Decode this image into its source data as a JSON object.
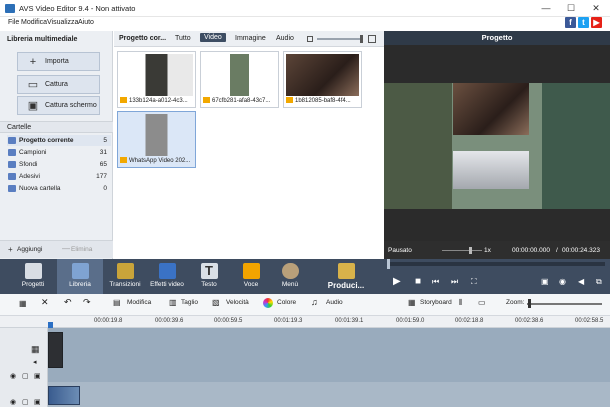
{
  "window": {
    "title": "AVS Video Editor 9.4 - Non attivato",
    "minimize": "—",
    "maximize": "☐",
    "close": "✕"
  },
  "menu": [
    "File",
    "Modifica",
    "Visualizza",
    "Aiuto"
  ],
  "social": {
    "facebook": "f",
    "twitter": "t",
    "youtube": "▶"
  },
  "library": {
    "title": "Libreria multimediale",
    "import_label": "Importa",
    "capture_label": "Cattura",
    "screen_capture_label": "Cattura schermo",
    "folders_title": "Cartelle",
    "folders": [
      {
        "name": "Progetto corrente",
        "count": "5"
      },
      {
        "name": "Campioni",
        "count": "31"
      },
      {
        "name": "Sfondi",
        "count": "65"
      },
      {
        "name": "Adesivi",
        "count": "177"
      },
      {
        "name": "Nuova cartella",
        "count": "0"
      }
    ],
    "add_label": "Aggiungi",
    "delete_label": "Elimina"
  },
  "media": {
    "project_label": "Progetto cor...",
    "tabs": [
      "Tutto",
      "Video",
      "Immagine",
      "Audio"
    ],
    "items": [
      {
        "name": "133b124a-a012-4c3..."
      },
      {
        "name": "67cfb281-afa8-43c7..."
      },
      {
        "name": "1b812085-baf8-4f4..."
      },
      {
        "name": "WhatsApp Video 202..."
      }
    ]
  },
  "preview": {
    "title": "Progetto",
    "status": "Pausato",
    "speed": "1x",
    "time_current": "00:00:00.000",
    "time_total": "00:00:24.323",
    "time_separator": "/"
  },
  "toolbar": {
    "items": [
      "Progetti",
      "Libreria",
      "Transizioni",
      "Effetti video",
      "Testo",
      "Voce",
      "Menù",
      "Produci..."
    ]
  },
  "timeline": {
    "tools": {
      "edit": "Modifica",
      "trim": "Taglio",
      "speed": "Velocità",
      "color": "Colore",
      "audio": "Audio",
      "storyboard": "Storyboard",
      "zoom": "Zoom:"
    },
    "ruler": [
      "00:00:19.8",
      "00:00:39.6",
      "00:00:59.5",
      "00:01:19.3",
      "00:01:39.1",
      "00:01:59.0",
      "00:02:18.8",
      "00:02:38.6",
      "00:02:58.5"
    ]
  },
  "colors": {
    "accent": "#3d4d63",
    "toolbar": "#3e4c60",
    "preview_bg": "#2b2b2b",
    "timeline_track": "#99abbd"
  }
}
